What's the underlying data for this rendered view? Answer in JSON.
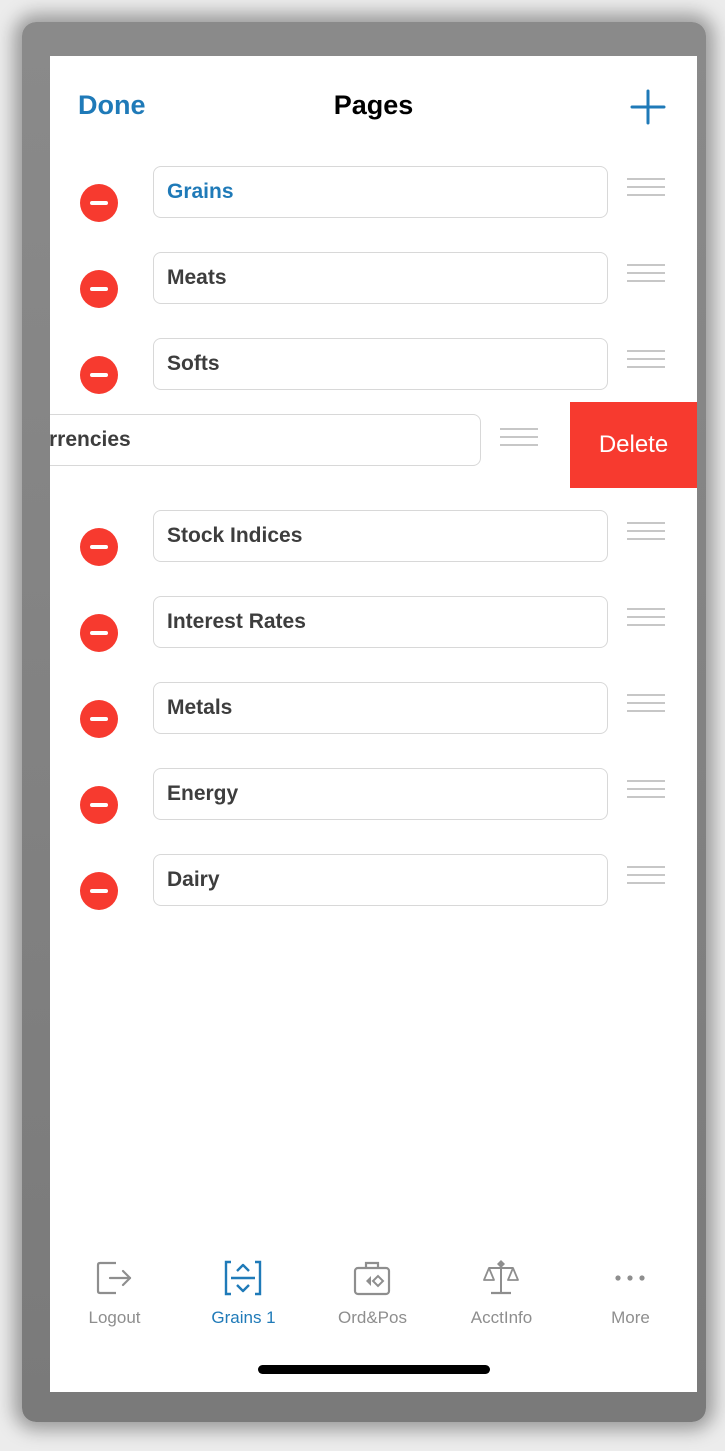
{
  "colors": {
    "accent": "#1f7ab8",
    "danger": "#f73a2f"
  },
  "header": {
    "done_label": "Done",
    "title": "Pages",
    "add_icon": "plus-icon"
  },
  "pages": [
    {
      "label": "Grains",
      "active": true
    },
    {
      "label": "Meats"
    },
    {
      "label": "Softs"
    },
    {
      "label": "Currencies",
      "swiped": true,
      "delete_label": "Delete"
    },
    {
      "label": "Stock Indices"
    },
    {
      "label": "Interest Rates"
    },
    {
      "label": "Metals"
    },
    {
      "label": "Energy"
    },
    {
      "label": "Dairy"
    }
  ],
  "tabbar": {
    "tabs": [
      {
        "label": "Logout",
        "icon": "logout-icon"
      },
      {
        "label": "Grains 1",
        "icon": "grains-page-icon",
        "active": true
      },
      {
        "label": "Ord&Pos",
        "icon": "briefcase-icon"
      },
      {
        "label": "AcctInfo",
        "icon": "scales-icon"
      },
      {
        "label": "More",
        "icon": "more-dots-icon"
      }
    ]
  }
}
